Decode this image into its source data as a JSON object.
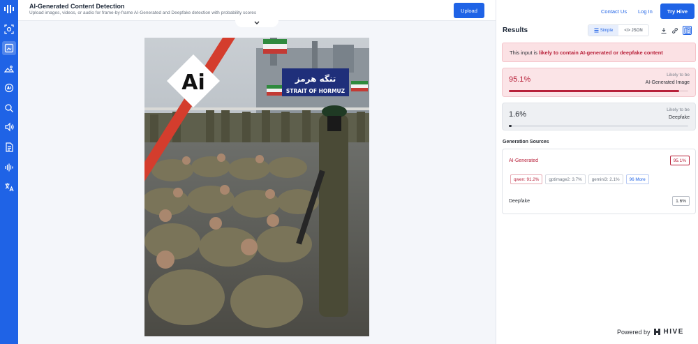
{
  "header": {
    "title": "AI-Generated Content Detection",
    "subtitle": "Upload images, videos, or audio for frame-by-frame AI-Generated and Deepfake detection with probability scores",
    "upload_label": "Upload"
  },
  "nav": {
    "contact": "Contact Us",
    "login": "Log In",
    "try": "Try Hive"
  },
  "sidebar": {
    "items": [
      {
        "icon": "scan-icon"
      },
      {
        "icon": "image-detect-icon"
      },
      {
        "icon": "landscape-icon"
      },
      {
        "icon": "ai-text-icon"
      },
      {
        "icon": "search-magnify-icon"
      },
      {
        "icon": "speaker-icon"
      },
      {
        "icon": "document-icon"
      },
      {
        "icon": "audio-waves-icon"
      },
      {
        "icon": "translate-icon"
      }
    ]
  },
  "preview": {
    "watermark": "Ai",
    "banner_text": "تنگه هرمز",
    "banner_caption": "STRAIT OF HORMUZ"
  },
  "results": {
    "heading": "Results",
    "view_simple": "Simple",
    "view_json": "</> JSON",
    "alert_prefix": "This input is ",
    "alert_highlight": "likely to contain AI-generated or deepfake content",
    "ai": {
      "pct_text": "95.1%",
      "likely": "Likely to be",
      "label": "AI-Generated Image",
      "value": 0.951
    },
    "deepfake": {
      "pct_text": "1.6%",
      "likely": "Likely to be",
      "label": "Deepfake",
      "value": 0.016
    },
    "sources_heading": "Generation Sources",
    "sources": {
      "ai_label": "AI-Generated",
      "ai_badge": "95.1%",
      "chips": [
        "qwen: 91.2%",
        "gptimage2: 3.7%",
        "gemini3: 2.1%",
        "96 More"
      ],
      "df_label": "Deepfake",
      "df_badge": "1.6%"
    }
  },
  "footer": {
    "powered_by": "Powered by",
    "brand": "HIVE"
  },
  "colors": {
    "accent": "#1f63e6",
    "danger": "#b8213a"
  }
}
